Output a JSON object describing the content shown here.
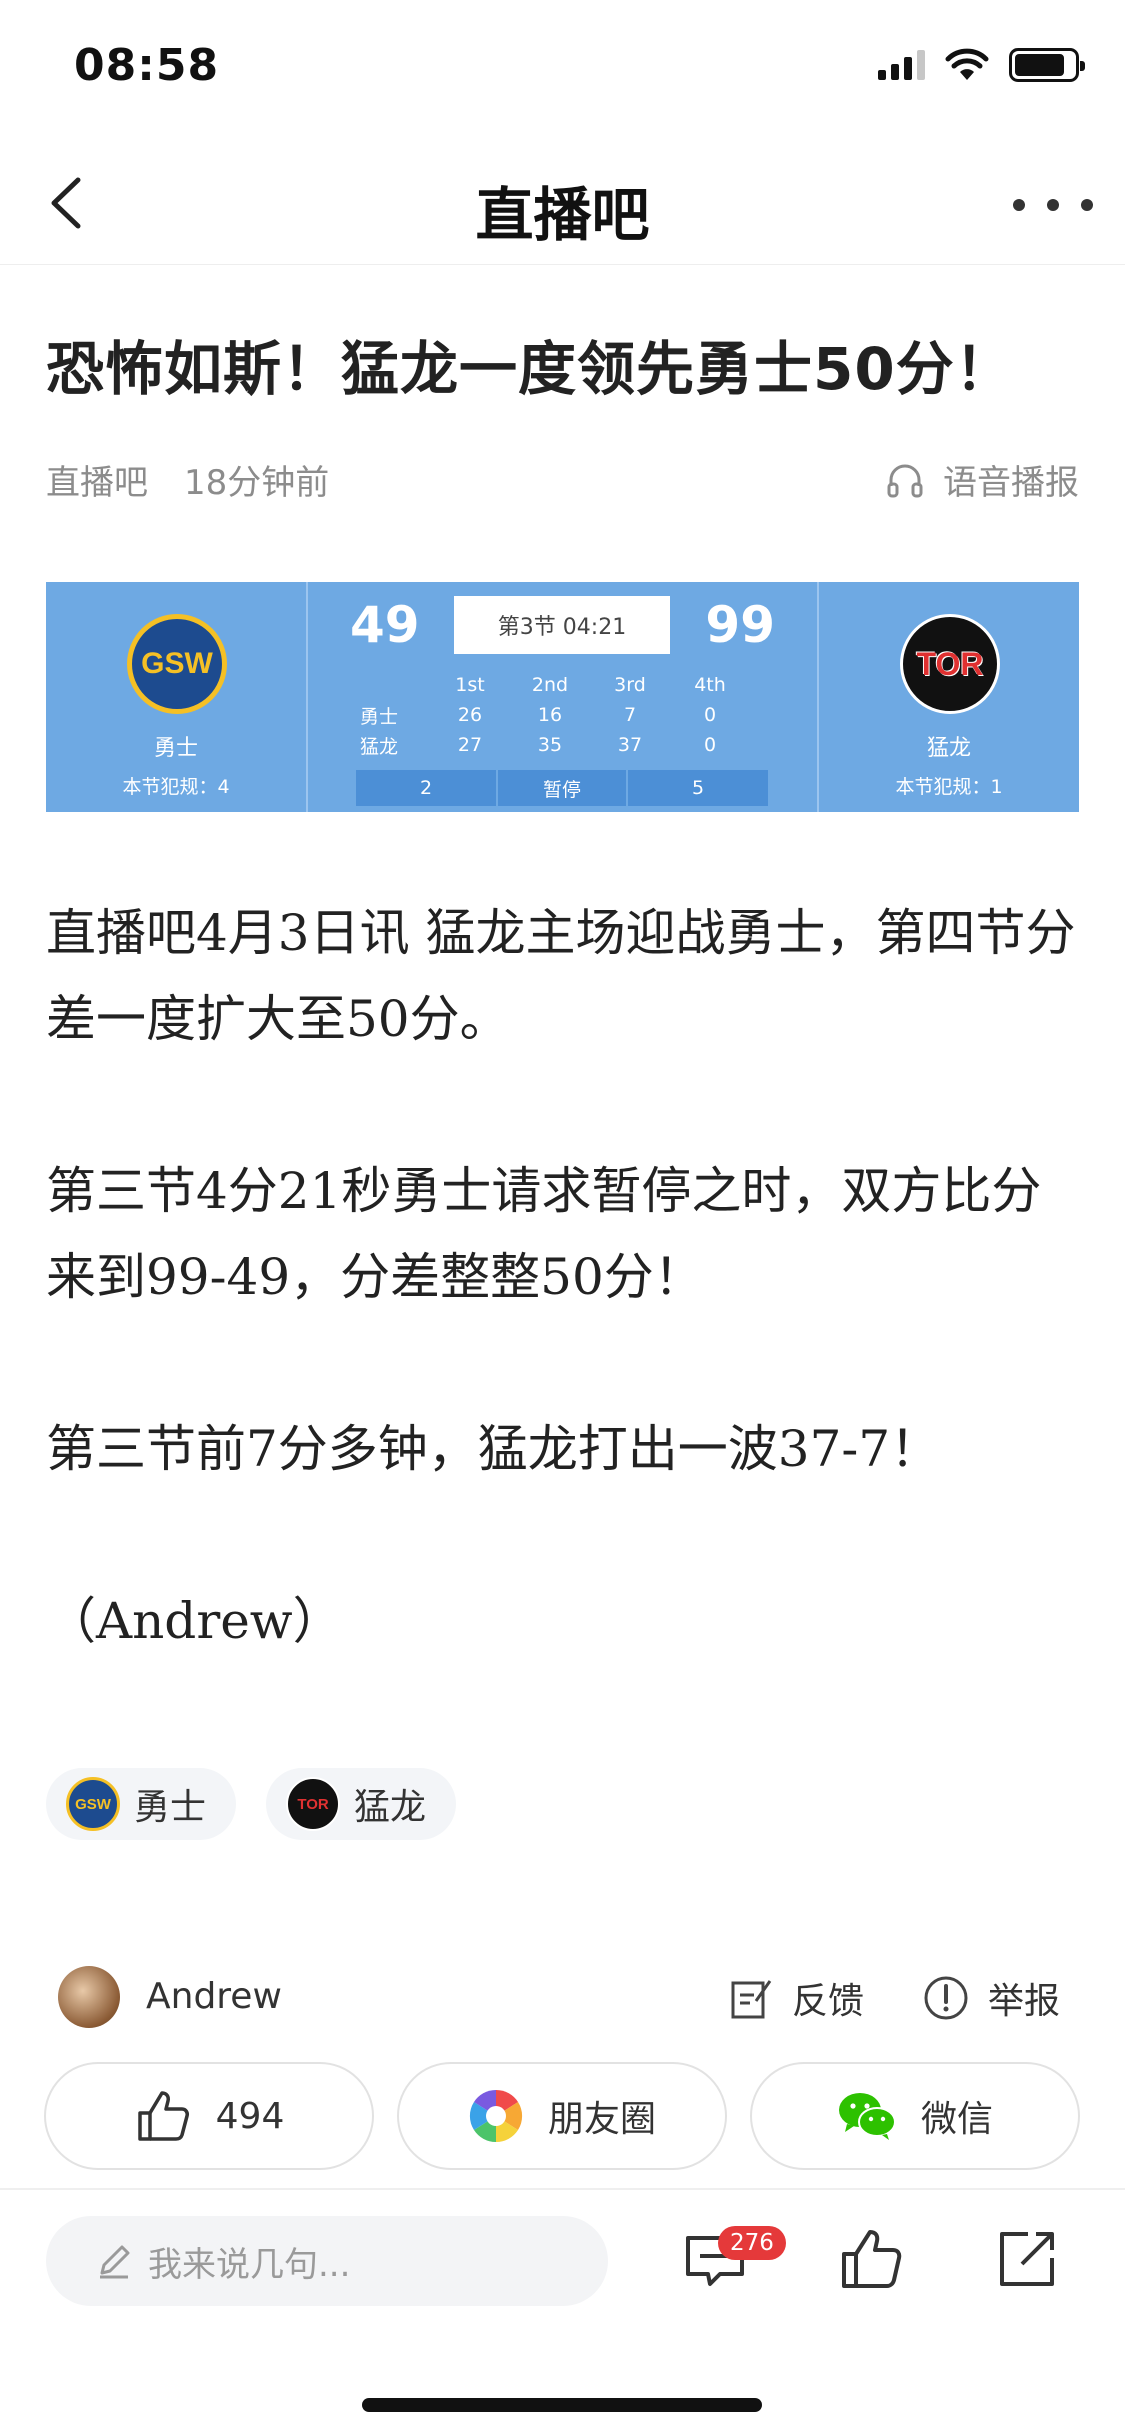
{
  "status_bar": {
    "time": "08:58",
    "signal_icon": "signal-icon",
    "wifi_icon": "wifi-icon",
    "battery_icon": "battery-icon"
  },
  "nav": {
    "title": "直播吧",
    "back_icon": "chevron-left-icon",
    "more_icon": "more-horizontal-icon"
  },
  "article": {
    "title": "恐怖如斯！猛龙一度领先勇士50分！",
    "source": "直播吧",
    "time_ago": "18分钟前",
    "audio_label": "语音播报",
    "paragraphs": [
      "直播吧4月3日讯 猛龙主场迎战勇士，第四节分差一度扩大至50分。",
      "第三节4分21秒勇士请求暂停之时，双方比分来到99-49，分差整整50分！",
      "第三节前7分多钟，猛龙打出一波37-7！",
      "（Andrew）"
    ]
  },
  "scoreboard": {
    "home": {
      "logo_text": "GSW",
      "name": "勇士",
      "fouls": "本节犯规：4",
      "score": "49",
      "timeouts": "2"
    },
    "away": {
      "logo_text": "TOR",
      "name": "猛龙",
      "fouls": "本节犯规：1",
      "score": "99",
      "timeouts": "5"
    },
    "period": "第3节 04:21",
    "quarters": [
      "1st",
      "2nd",
      "3rd",
      "4th"
    ],
    "rows": [
      {
        "team": "勇士",
        "scores": [
          "26",
          "16",
          "7",
          "0"
        ]
      },
      {
        "team": "猛龙",
        "scores": [
          "27",
          "35",
          "37",
          "0"
        ]
      }
    ],
    "timeout_label": "暂停",
    "colors": {
      "background": "#6ea9e3",
      "bar": "#4c8fd6"
    }
  },
  "tags": [
    {
      "label": "勇士",
      "logo_text": "GSW"
    },
    {
      "label": "猛龙",
      "logo_text": "TOR"
    }
  ],
  "author": {
    "name": "Andrew",
    "feedback_label": "反馈",
    "report_label": "举报"
  },
  "actions": [
    {
      "label": "494",
      "icon": "thumbs-up-icon"
    },
    {
      "label": "朋友圈",
      "icon": "moments-icon"
    },
    {
      "label": "微信",
      "icon": "wechat-icon"
    }
  ],
  "bottom_bar": {
    "comment_placeholder": "我来说几句...",
    "comment_count": "276",
    "accent": "#e5393a"
  }
}
